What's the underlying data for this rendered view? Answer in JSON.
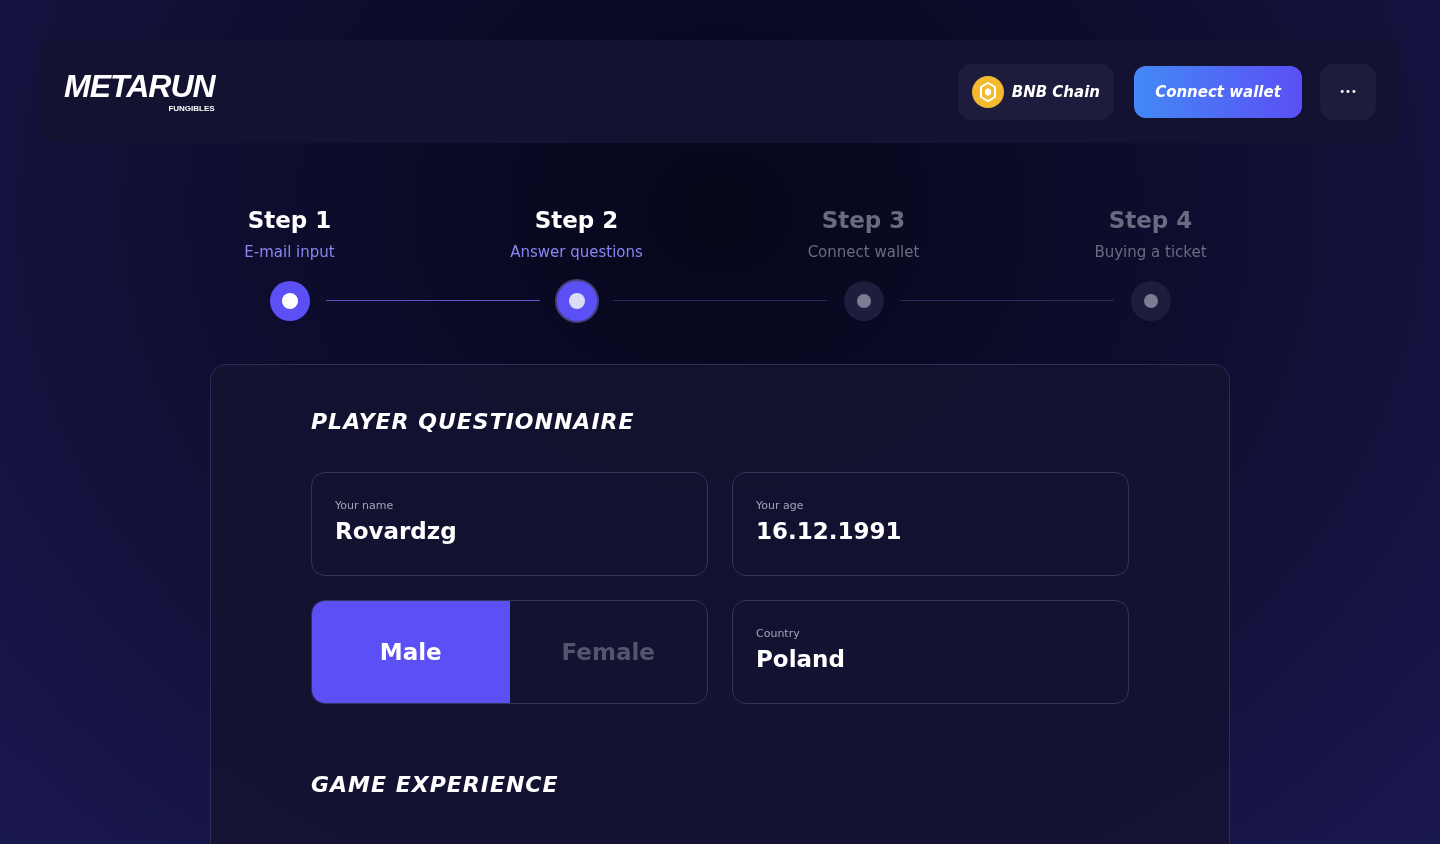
{
  "header": {
    "logo": {
      "name": "METARUN",
      "byline": "FUNGIBLES"
    },
    "network": {
      "label": "BNB Chain"
    },
    "connect_button": "Connect wallet",
    "more_button": "•••"
  },
  "steps": [
    {
      "title": "Step 1",
      "subtitle": "E-mail input",
      "reached": true,
      "selected": false
    },
    {
      "title": "Step 2",
      "subtitle": "Answer questions",
      "reached": true,
      "selected": true
    },
    {
      "title": "Step 3",
      "subtitle": "Connect wallet",
      "reached": false,
      "selected": false
    },
    {
      "title": "Step 4",
      "subtitle": "Buying a ticket",
      "reached": false,
      "selected": false
    }
  ],
  "questionnaire": {
    "title": "PLAYER QUESTIONNAIRE",
    "name_field": {
      "label": "Your name",
      "value": "Rovardzg"
    },
    "age_field": {
      "label": "Your age",
      "value": "16.12.1991"
    },
    "gender": [
      {
        "label": "Male",
        "selected": true
      },
      {
        "label": "Female",
        "selected": false
      }
    ],
    "country_field": {
      "label": "Country",
      "value": "Poland"
    }
  },
  "next_section": {
    "title": "GAME EXPERIENCE"
  }
}
